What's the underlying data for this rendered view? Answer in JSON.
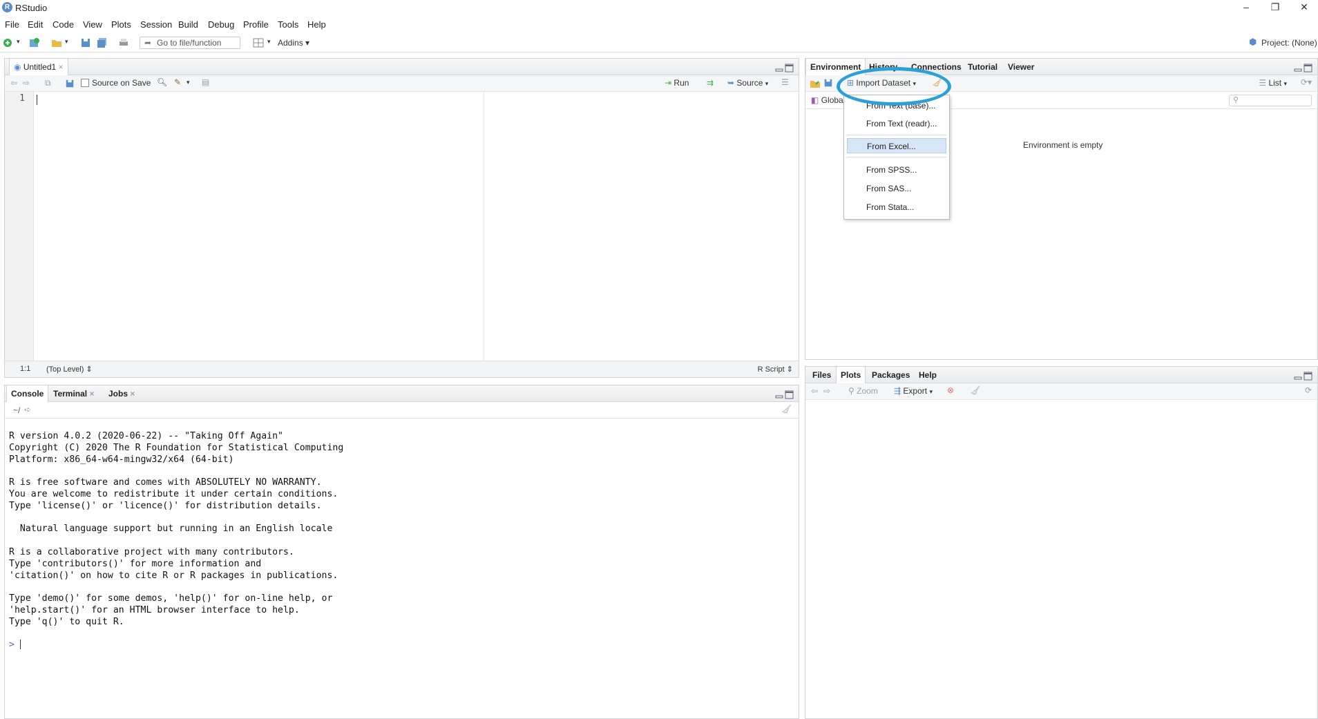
{
  "window": {
    "title": "RStudio",
    "minimize_glyph": "–",
    "restore_glyph": "❐",
    "close_glyph": "✕"
  },
  "menubar": [
    "File",
    "Edit",
    "Code",
    "View",
    "Plots",
    "Session",
    "Build",
    "Debug",
    "Profile",
    "Tools",
    "Help"
  ],
  "toolbar": {
    "goto_placeholder": "Go to file/function",
    "addins_label": "Addins",
    "project_label": "Project: (None)"
  },
  "editor": {
    "tab_label": "Untitled1",
    "source_on_save_label": "Source on Save",
    "run_label": "Run",
    "source_label": "Source",
    "line_number": "1",
    "status_position": "1:1",
    "status_scope": "(Top Level)",
    "status_filetype": "R Script"
  },
  "console_pane": {
    "tabs": [
      "Console",
      "Terminal",
      "Jobs"
    ],
    "working_dir": "~/",
    "lines": [
      "R version 4.0.2 (2020-06-22) -- \"Taking Off Again\"",
      "Copyright (C) 2020 The R Foundation for Statistical Computing",
      "Platform: x86_64-w64-mingw32/x64 (64-bit)",
      "",
      "R is free software and comes with ABSOLUTELY NO WARRANTY.",
      "You are welcome to redistribute it under certain conditions.",
      "Type 'license()' or 'licence()' for distribution details.",
      "",
      "  Natural language support but running in an English locale",
      "",
      "R is a collaborative project with many contributors.",
      "Type 'contributors()' for more information and",
      "'citation()' on how to cite R or R packages in publications.",
      "",
      "Type 'demo()' for some demos, 'help()' for on-line help, or",
      "'help.start()' for an HTML browser interface to help.",
      "Type 'q()' to quit R.",
      ""
    ],
    "prompt": ">"
  },
  "env_pane": {
    "tabs": [
      "Environment",
      "History",
      "Connections",
      "Tutorial",
      "Viewer"
    ],
    "import_label": "Import Dataset",
    "list_label": "List",
    "global_env_label": "Global",
    "empty_message": "Environment is empty",
    "import_menu": [
      "From Text (base)...",
      "From Text (readr)...",
      "From Excel...",
      "From SPSS...",
      "From SAS...",
      "From Stata..."
    ]
  },
  "files_pane": {
    "tabs": [
      "Files",
      "Plots",
      "Packages",
      "Help"
    ],
    "zoom_label": "Zoom",
    "export_label": "Export"
  },
  "colors": {
    "accent_annotation": "#2b9fd8",
    "menu_highlight": "#d7e6f6"
  }
}
